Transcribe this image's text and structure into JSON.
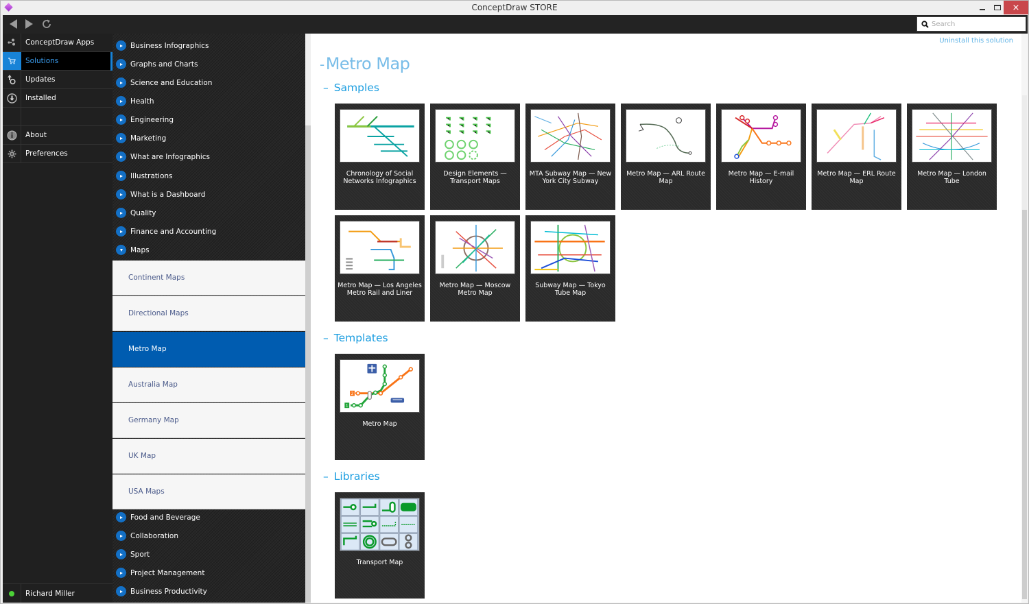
{
  "window": {
    "title": "ConceptDraw STORE",
    "controls": {
      "minimize": "minimize",
      "maximize": "maximize",
      "close": "×"
    }
  },
  "toolbar": {
    "search_placeholder": "Search"
  },
  "leftnav": {
    "items": [
      {
        "label": "ConceptDraw Apps",
        "icon": "apps-icon"
      },
      {
        "label": "Solutions",
        "icon": "cart-icon",
        "active": true
      },
      {
        "label": "Updates",
        "icon": "updates-icon"
      },
      {
        "label": "Installed",
        "icon": "download-icon"
      },
      {
        "label": "About",
        "icon": "info-icon"
      },
      {
        "label": "Preferences",
        "icon": "gear-icon"
      }
    ],
    "user": {
      "name": "Richard Miller",
      "status_color": "#4cd137"
    }
  },
  "categories": {
    "top": [
      "Business Infographics",
      "Graphs and Charts",
      "Science and Education",
      "Health",
      "Engineering",
      "Marketing",
      "What are Infographics",
      "Illustrations",
      "What is a Dashboard",
      "Quality",
      "Finance and Accounting",
      "Maps"
    ],
    "maps_sub": [
      "Continent Maps",
      "Directional Maps",
      "Metro Map",
      "Australia Map",
      "Germany Map",
      "UK Map",
      "USA Maps"
    ],
    "active_sub": "Metro Map",
    "bottom": [
      "Food and Beverage",
      "Collaboration",
      "Sport",
      "Project Management",
      "Business Productivity"
    ]
  },
  "content": {
    "uninstall_label": "Uninstall this solution",
    "title": "Metro Map",
    "sections": {
      "samples": {
        "title": "Samples",
        "items": [
          "Chronology of Social Networks Infographics",
          "Design Elements — Transport Maps",
          "MTA Subway Map — New York City Subway",
          "Metro Map — ARL Route Map",
          "Metro Map — E-mail History",
          "Metro Map — ERL Route Map",
          "Metro Map — London Tube",
          "Metro Map — Los Angeles Metro Rail and Liner",
          "Metro Map — Moscow Metro Map",
          "Subway Map — Tokyo Tube Map"
        ]
      },
      "templates": {
        "title": "Templates",
        "items": [
          "Metro Map"
        ],
        "line_labels": [
          "1",
          "2"
        ]
      },
      "libraries": {
        "title": "Libraries",
        "items": [
          "Transport Map"
        ]
      }
    }
  },
  "colors": {
    "accent": "#1883d7",
    "active_sub_bg": "#005cb0",
    "heading": "#1a9de0",
    "title": "#79bde8"
  }
}
